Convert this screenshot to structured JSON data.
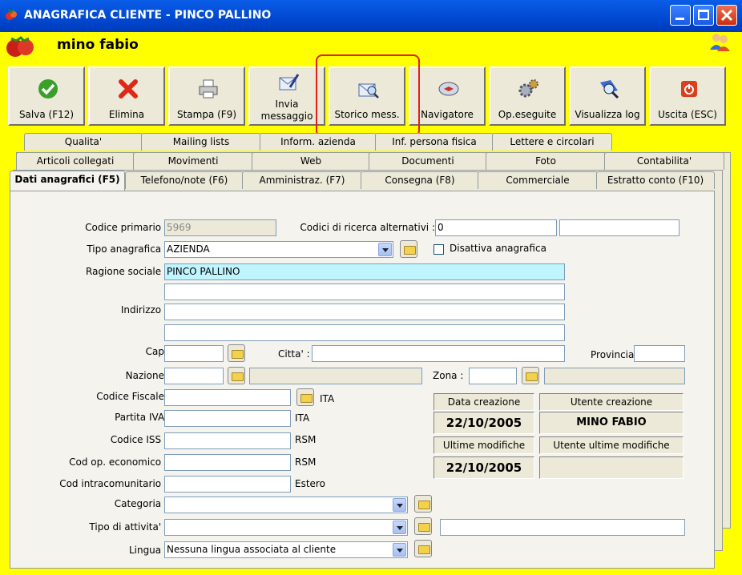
{
  "window": {
    "title": "ANAGRAFICA CLIENTE - PINCO PALLINO"
  },
  "header": {
    "user_name": "mino fabio"
  },
  "toolbar": [
    {
      "label": "Salva (F12)",
      "icon": "check-icon"
    },
    {
      "label": "Elimina",
      "icon": "delete-x-icon"
    },
    {
      "label": "Stampa (F9)",
      "icon": "printer-icon"
    },
    {
      "label": "Invia messaggio",
      "icon": "envelope-pen-icon"
    },
    {
      "label": "Storico mess.",
      "icon": "envelope-search-icon"
    },
    {
      "label": "Navigatore",
      "icon": "compass-icon"
    },
    {
      "label": "Op.eseguite",
      "icon": "gears-icon"
    },
    {
      "label": "Visualizza log",
      "icon": "log-search-icon"
    },
    {
      "label": "Uscita (ESC)",
      "icon": "exit-icon"
    }
  ],
  "tabs": {
    "row1": [
      "Qualita'",
      "Mailing lists",
      "Inform. azienda",
      "Inf. persona fisica",
      "Lettere e circolari"
    ],
    "row2": [
      "Articoli collegati",
      "Movimenti",
      "Web",
      "Documenti",
      "Foto",
      "Contabilita'"
    ],
    "row3": [
      "Dati anagrafici (F5)",
      "Telefono/note (F6)",
      "Amministraz. (F7)",
      "Consegna (F8)",
      "Commerciale",
      "Estratto conto (F10)"
    ]
  },
  "form": {
    "codice_primario_label": "Codice primario :",
    "codice_primario": "5969",
    "codici_alt_label": "Codici di ricerca alternativi :",
    "codice_alt_1": "0",
    "codice_alt_2": "",
    "tipo_anagrafica_label": "Tipo anagrafica :",
    "tipo_anagrafica": "AZIENDA",
    "disattiva_label": "Disattiva anagrafica",
    "ragione_sociale_label": "Ragione sociale :",
    "ragione_sociale": "PINCO PALLINO",
    "ragione_sociale_2": "",
    "indirizzo_label": "Indirizzo :",
    "indirizzo_1": "",
    "indirizzo_2": "",
    "cap_label": "Cap:",
    "cap": "",
    "citta_label": "Citta' :",
    "citta": "",
    "provincia_label": "Provincia:",
    "provincia": "",
    "nazione_label": "Nazione:",
    "nazione": "",
    "zona_label": "Zona :",
    "zona": "",
    "codice_fiscale_label": "Codice Fiscale:",
    "codice_fiscale_suffix": "ITA",
    "partita_iva_label": "Partita IVA:",
    "partita_iva_suffix": "ITA",
    "codice_iss_label": "Codice ISS :",
    "codice_iss_suffix": "RSM",
    "cod_op_label": "Cod  op. economico :",
    "cod_op_suffix": "RSM",
    "cod_intra_label": "Cod  intracomunitario :",
    "cod_intra_suffix": "Estero",
    "categoria_label": "Categoria :",
    "categoria": "",
    "tipo_attivita_label": "Tipo di attivita' :",
    "tipo_attivita": "",
    "lingua_label": "Lingua :",
    "lingua": "Nessuna lingua associata al cliente"
  },
  "info": {
    "data_creazione_label": "Data creazione",
    "data_creazione": "22/10/2005",
    "utente_creazione_label": "Utente creazione",
    "utente_creazione": "MINO FABIO",
    "ultime_modifiche_label": "Ultime modifiche",
    "ultime_modifiche": "22/10/2005",
    "utente_ultime_label": "Utente ultime modifiche",
    "utente_ultime": ""
  }
}
